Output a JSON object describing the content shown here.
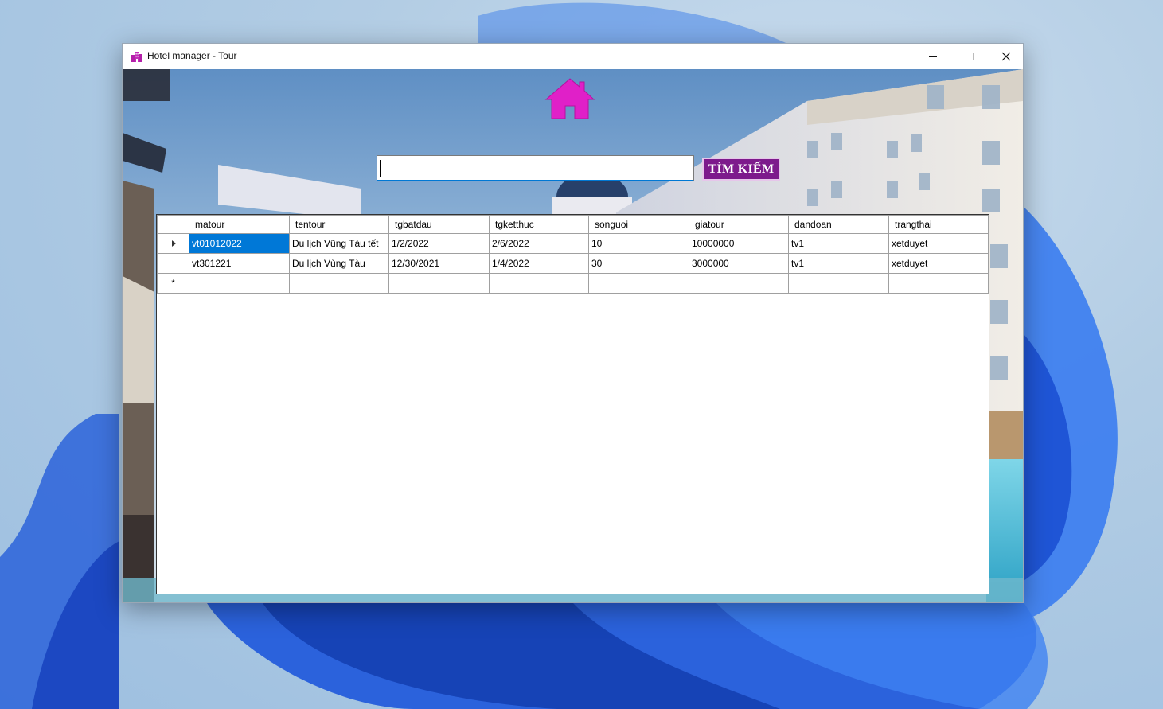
{
  "window": {
    "title": "Hotel manager - Tour"
  },
  "search": {
    "value": "",
    "button_label": "TÌM KIẾM"
  },
  "table": {
    "columns": [
      "matour",
      "tentour",
      "tgbatdau",
      "tgketthuc",
      "songuoi",
      "giatour",
      "dandoan",
      "trangthai"
    ],
    "rows": [
      [
        "vt01012022",
        "Du lịch Vũng Tàu tết",
        "1/2/2022",
        "2/6/2022",
        "10",
        "10000000",
        "tv1",
        "xetduyet"
      ],
      [
        "vt301221",
        "Du lịch Vùng Tàu",
        "12/30/2021",
        "1/4/2022",
        "30",
        "3000000",
        "tv1",
        "xetduyet"
      ]
    ],
    "new_row_marker": "*"
  },
  "colors": {
    "accent_button": "#7d1a8c",
    "home_icon": "#e020c8",
    "selection": "#0078d7"
  },
  "icons": {
    "app": "hotel-building-icon",
    "home": "home-icon",
    "minimize": "minimize-icon",
    "maximize": "maximize-icon",
    "close": "close-icon"
  }
}
